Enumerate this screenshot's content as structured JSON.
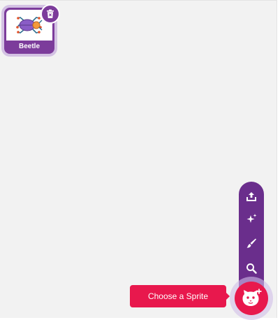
{
  "sprite_list": {
    "sprites": [
      {
        "name": "Beetle",
        "icon": "beetle-icon",
        "selected": true
      }
    ],
    "delete_icon": "trash-icon"
  },
  "sprite_menu": {
    "tooltip": "Choose a Sprite",
    "items": [
      {
        "icon": "upload-icon"
      },
      {
        "icon": "surprise-sparkle-icon"
      },
      {
        "icon": "paint-brush-icon"
      },
      {
        "icon": "search-icon"
      }
    ],
    "main_icon": "cat-face-plus-icon"
  },
  "colors": {
    "sprite_tile": "#7c3c9b",
    "menu_column": "#6a2e8c",
    "fab": "#e8184d",
    "background": "#f2f2f2"
  }
}
